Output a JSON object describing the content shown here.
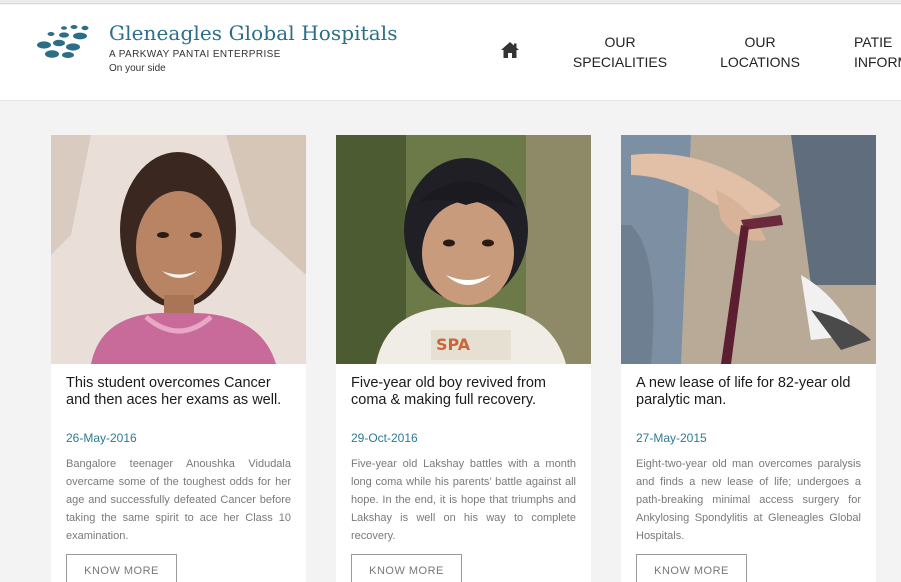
{
  "brand": {
    "name": "Gleneagles Global Hospitals",
    "tagline": "A PARKWAY PANTAI ENTERPRISE",
    "slogan": "On your side",
    "color": "#2b6f86"
  },
  "nav": {
    "home_icon": "home-icon",
    "items": [
      {
        "line1": "OUR",
        "line2": "SPECIALITIES"
      },
      {
        "line1": "OUR",
        "line2": "LOCATIONS"
      },
      {
        "line1": "PATIE",
        "line2": "INFORM"
      }
    ]
  },
  "stories": [
    {
      "title": "This student overcomes Cancer and then aces her exams as well.",
      "date": "26-May-2016",
      "description": "Bangalore teenager Anoushka Vidudala overcame some of the toughest odds for her age and successfully defeated Cancer before taking the same spirit to ace her Class 10 examination.",
      "button": "KNOW MORE"
    },
    {
      "title": "Five-year old boy revived from coma & making full recovery.",
      "date": "29-Oct-2016",
      "description": "Five-year old Lakshay battles with a month long coma while his parents’ battle against all hope. In the end, it is hope that triumphs and Lakshay is well on his way to complete recovery.",
      "button": "KNOW MORE"
    },
    {
      "title": "A new lease of life for 82-year old paralytic man.",
      "date": "27-May-2015",
      "description": "Eight-two-year old man overcomes paralysis and finds a new lease of life; undergoes a path-breaking minimal access surgery for Ankylosing Spondylitis at Gleneagles Global Hospitals.",
      "button": "KNOW MORE"
    }
  ]
}
